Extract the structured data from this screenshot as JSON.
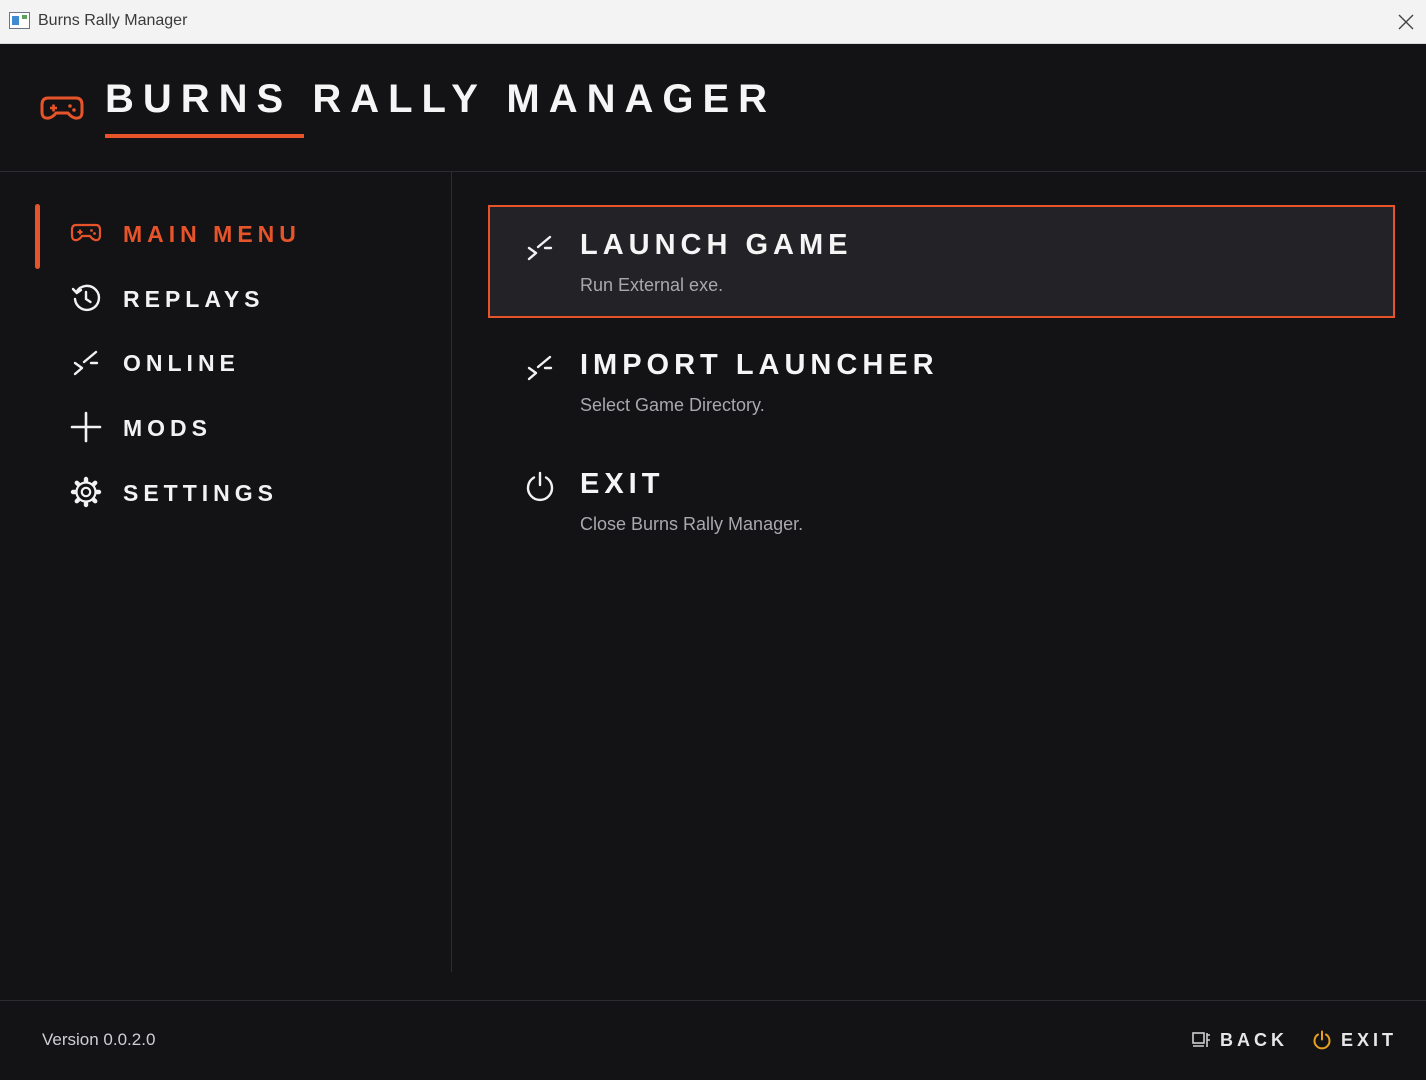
{
  "window": {
    "title": "Burns Rally Manager",
    "close_icon": "close-icon"
  },
  "header": {
    "app_name": "BURNS RALLY MANAGER",
    "logo_icon": "gamepad-icon",
    "accent_color": "#e8542a"
  },
  "sidebar": {
    "items": [
      {
        "label": "MAIN MENU",
        "icon": "gamepad-icon",
        "active": true
      },
      {
        "label": "REPLAYS",
        "icon": "history-icon",
        "active": false
      },
      {
        "label": "ONLINE",
        "icon": "online-icon",
        "active": false
      },
      {
        "label": "MODS",
        "icon": "plus-icon",
        "active": false
      },
      {
        "label": "SETTINGS",
        "icon": "gear-icon",
        "active": false
      }
    ]
  },
  "main": {
    "actions": [
      {
        "title": "LAUNCH GAME",
        "subtitle": "Run External exe.",
        "icon": "launch-icon",
        "selected": true
      },
      {
        "title": "IMPORT LAUNCHER",
        "subtitle": "Select Game Directory.",
        "icon": "import-icon",
        "selected": false
      },
      {
        "title": "EXIT",
        "subtitle": "Close Burns Rally Manager.",
        "icon": "power-icon",
        "selected": false
      }
    ]
  },
  "footer": {
    "version": "Version 0.0.2.0",
    "back_label": "BACK",
    "exit_label": "EXIT",
    "back_icon": "back-icon",
    "exit_icon": "power-icon",
    "exit_icon_color": "#e8a020"
  }
}
